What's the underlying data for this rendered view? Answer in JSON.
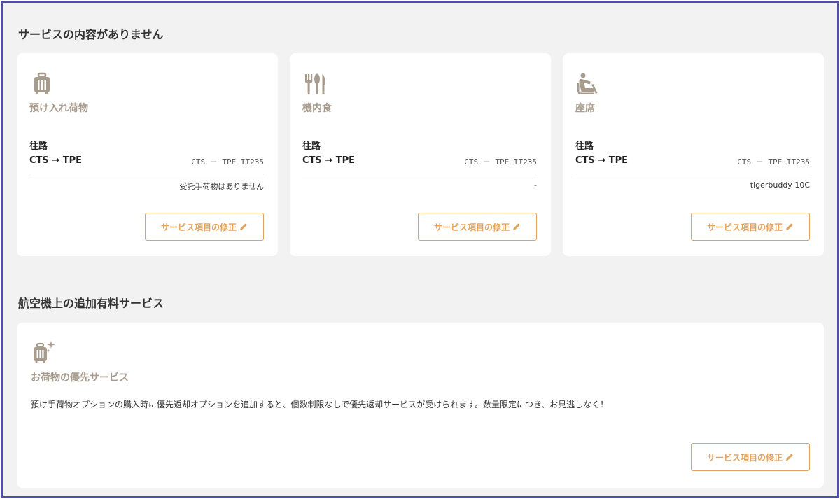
{
  "sections": {
    "services_title": "サービスの内容がありません",
    "addons_title": "航空機上の追加有料サービス"
  },
  "cards": [
    {
      "icon": "suitcase-icon",
      "title": "預け入れ荷物",
      "direction": "往路",
      "route": "CTS → TPE",
      "flight": "CTS － TPE IT235",
      "value": "受託手荷物はありません",
      "button": "サービス項目の修正"
    },
    {
      "icon": "fork-knife-icon",
      "title": "機内食",
      "direction": "往路",
      "route": "CTS → TPE",
      "flight": "CTS － TPE IT235",
      "value": "-",
      "button": "サービス項目の修正"
    },
    {
      "icon": "seat-icon",
      "title": "座席",
      "direction": "往路",
      "route": "CTS → TPE",
      "flight": "CTS － TPE IT235",
      "value": "tigerbuddy 10C",
      "button": "サービス項目の修正"
    }
  ],
  "promo": {
    "icon": "sparkle-suitcase-icon",
    "title": "お荷物の優先サービス",
    "description": "預け手荷物オプションの購入時に優先返却オプションを追加すると、個数制限なしで優先返却サービスが受けられます。数量限定につき、お見逃しなく！",
    "button": "サービス項目の修正"
  },
  "colors": {
    "accent": "#e3a35e",
    "icon": "#a89c8e",
    "frame": "#4a4fb0",
    "background": "#f2f2f2"
  }
}
